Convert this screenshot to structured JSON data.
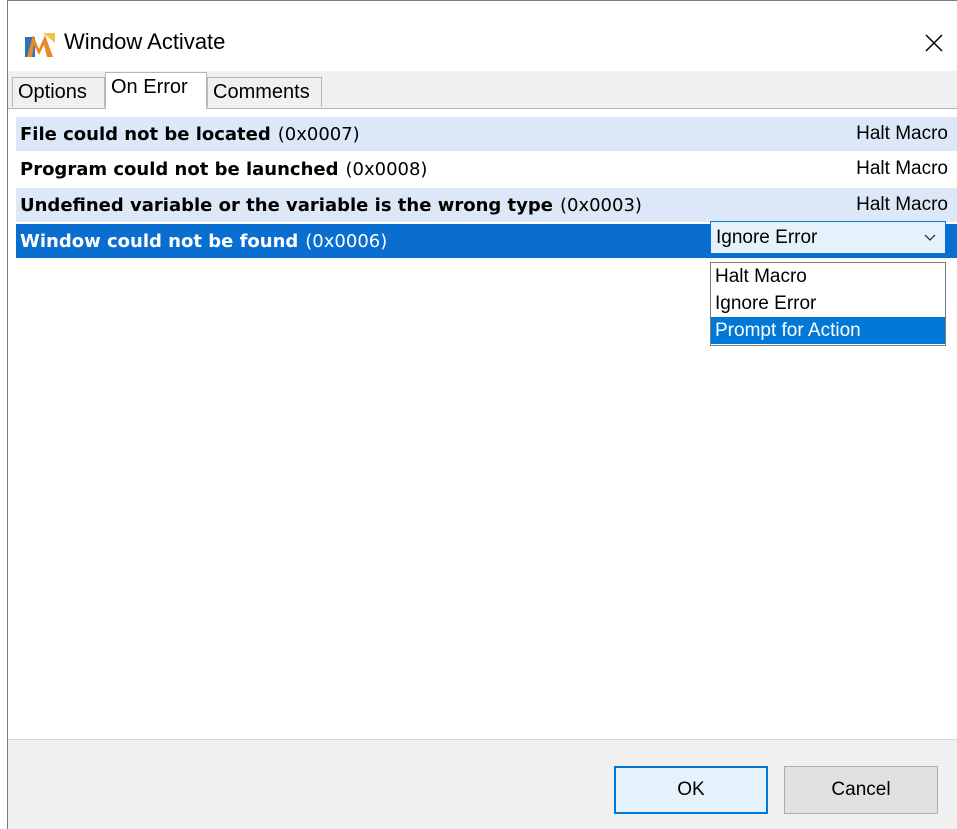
{
  "window": {
    "title": "Window Activate"
  },
  "tabs": [
    {
      "label": "Options",
      "active": false
    },
    {
      "label": "On Error",
      "active": true
    },
    {
      "label": "Comments",
      "active": false
    }
  ],
  "errors": [
    {
      "name": "File could not be located",
      "code": "(0x0007)",
      "action": "Halt Macro"
    },
    {
      "name": "Program could not be launched",
      "code": "(0x0008)",
      "action": "Halt Macro"
    },
    {
      "name": "Undefined variable or the variable is the wrong type",
      "code": "(0x0003)",
      "action": "Halt Macro"
    },
    {
      "name": "Window could not be found",
      "code": "(0x0006)",
      "action": "Ignore Error"
    }
  ],
  "action_dropdown": {
    "selected": "Ignore Error",
    "options": [
      "Halt Macro",
      "Ignore Error",
      "Prompt for Action"
    ],
    "highlighted": "Prompt for Action"
  },
  "buttons": {
    "ok": "OK",
    "cancel": "Cancel"
  },
  "colors": {
    "selection": "#0a6ed1",
    "alt_row": "#dce8f8",
    "accent": "#0078d7"
  }
}
